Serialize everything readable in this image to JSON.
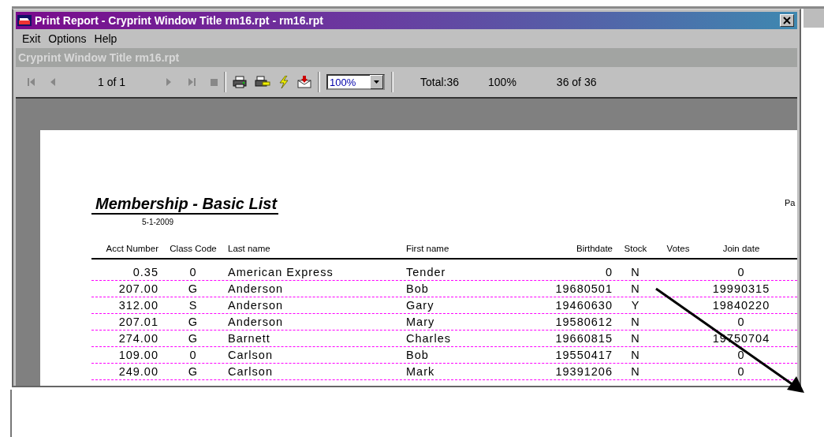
{
  "window": {
    "title": "Print Report - Cryprint Window Title rm16.rpt - rm16.rpt"
  },
  "menu": [
    {
      "label": "Exit"
    },
    {
      "label": "Options"
    },
    {
      "label": "Help"
    }
  ],
  "subtitle": "Cryprint Window Title rm16.rpt",
  "toolbar": {
    "nav_left": [
      {
        "kind": "first"
      },
      {
        "kind": "prev"
      }
    ],
    "page_indicator": "1 of 1",
    "nav_right": [
      {
        "kind": "next"
      },
      {
        "kind": "last"
      },
      {
        "kind": "stop"
      }
    ],
    "actions": [
      {
        "kind": "print"
      },
      {
        "kind": "printer-setup"
      },
      {
        "kind": "refresh"
      },
      {
        "kind": "export"
      }
    ],
    "zoom": "100%",
    "total": "Total:36",
    "percent": "100%",
    "records": "36 of 36"
  },
  "report": {
    "title": "Membership - Basic List",
    "date": "5-1-2009",
    "page_label": "Pa",
    "columns": [
      {
        "label": "Acct Number"
      },
      {
        "label": "Class Code"
      },
      {
        "label": "Last name"
      },
      {
        "label": "First name"
      },
      {
        "label": "Birthdate"
      },
      {
        "label": "Stock"
      },
      {
        "label": "Votes"
      },
      {
        "label": "Join date"
      }
    ],
    "rows": [
      [
        "0.35",
        "0",
        "American Express",
        "Tender",
        "0",
        "N",
        "",
        "0"
      ],
      [
        "207.00",
        "G",
        "Anderson",
        "Bob",
        "19680501",
        "N",
        "",
        "19990315"
      ],
      [
        "312.00",
        "S",
        "Anderson",
        "Gary",
        "19460630",
        "Y",
        "",
        "19840220"
      ],
      [
        "207.01",
        "G",
        "Anderson",
        "Mary",
        "19580612",
        "N",
        "",
        "0"
      ],
      [
        "274.00",
        "G",
        "Barnett",
        "Charles",
        "19660815",
        "N",
        "",
        "19750704"
      ],
      [
        "109.00",
        "0",
        "Carlson",
        "Bob",
        "19550417",
        "N",
        "",
        "0"
      ],
      [
        "249.00",
        "G",
        "Carlson",
        "Mark",
        "19391206",
        "N",
        "",
        "0"
      ]
    ]
  }
}
